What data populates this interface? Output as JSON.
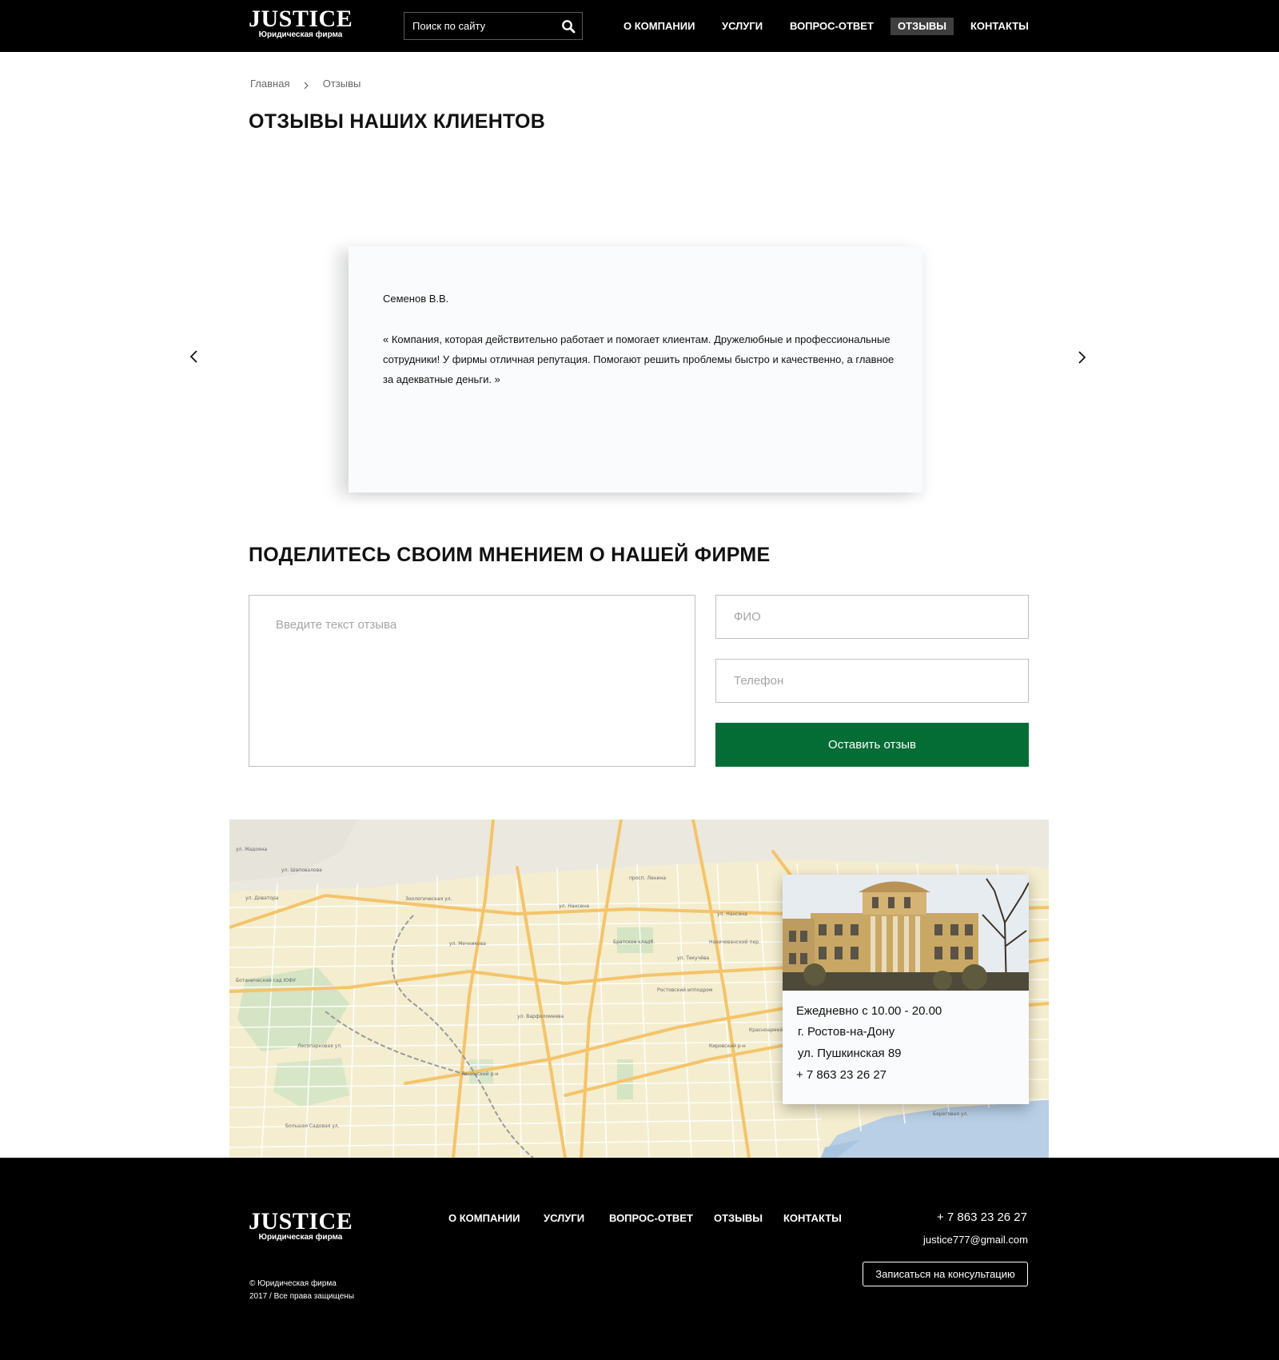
{
  "header": {
    "logo_title": "JUSTICE",
    "logo_subtitle": "Юридическая фирма",
    "search_placeholder": "Поиск по сайту",
    "search_icon": "search-icon",
    "nav": [
      {
        "label": "О компании",
        "active": false
      },
      {
        "label": "Услуги",
        "active": false
      },
      {
        "label": "Вопрос-ответ",
        "active": false
      },
      {
        "label": "Отзывы",
        "active": true
      },
      {
        "label": "Контакты",
        "active": false
      }
    ]
  },
  "breadcrumb": {
    "home": "Главная",
    "current": "Отзывы",
    "separator_icon": "chevron-right-icon"
  },
  "page_title": "Отзывы наших клиентов",
  "slider": {
    "prev_icon": "chevron-left-icon",
    "next_icon": "chevron-right-icon",
    "review": {
      "author": "Семенов В.В.",
      "text": "« Компания, которая действительно работает и помогает клиентам. Дружелюбные и профессиональные сотрудники! У фирмы отличная репутация. Помогают решить проблемы быстро и качественно, а главное за адекватные деньги. »"
    }
  },
  "form": {
    "title": "Поделитесь своим мнением о нашей фирме",
    "review_placeholder": "Введите текст отзыва",
    "name_placeholder": "ФИО",
    "phone_placeholder": "Телефон",
    "submit_label": "Оставить отзыв",
    "submit_color": "#046c35"
  },
  "contact_card": {
    "hours": "Ежедневно с 10.00 - 20.00",
    "city": "г. Ростов-на-Дону",
    "street": "ул. Пушкинская 89",
    "phone": "+ 7 863 23 26 27"
  },
  "map": {
    "streets": [
      "ул. Нансена",
      "ул. Текучёва",
      "Красноармейская ул.",
      "Большая Садовая ул.",
      "ул. Мечникова",
      "ул. Варфоломеева",
      "просп. Ленина",
      "Зоологическая ул.",
      "Кировский р-н",
      "Ленинский р-н",
      "ул. Доватора",
      "Лесопарковая ул.",
      "Береговая ул.",
      "Театральный просп.",
      "ул. Шаповалова",
      "ул. Мадояна",
      "Ботанический сад ЮФУ",
      "Ростовский ипподром",
      "Братское кладб.",
      "Нахичеванский пер."
    ]
  },
  "footer": {
    "logo_title": "JUSTICE",
    "logo_subtitle": "Юридическая фирма",
    "nav": [
      "О компании",
      "Услуги",
      "Вопрос-ответ",
      "Отзывы",
      "Контакты"
    ],
    "phone": "+ 7 863 23 26 27",
    "email": "justice777@gmail.com",
    "cta_label": "Записаться на консультацию",
    "copyright_line1": "© Юридическая фирма",
    "copyright_line2": "2017 / Все права защищены"
  },
  "colors": {
    "header_bg": "#000000",
    "nav_active_bg": "#3e3e3e",
    "accent_green": "#046c35",
    "map_water": "#b8cfe6"
  }
}
